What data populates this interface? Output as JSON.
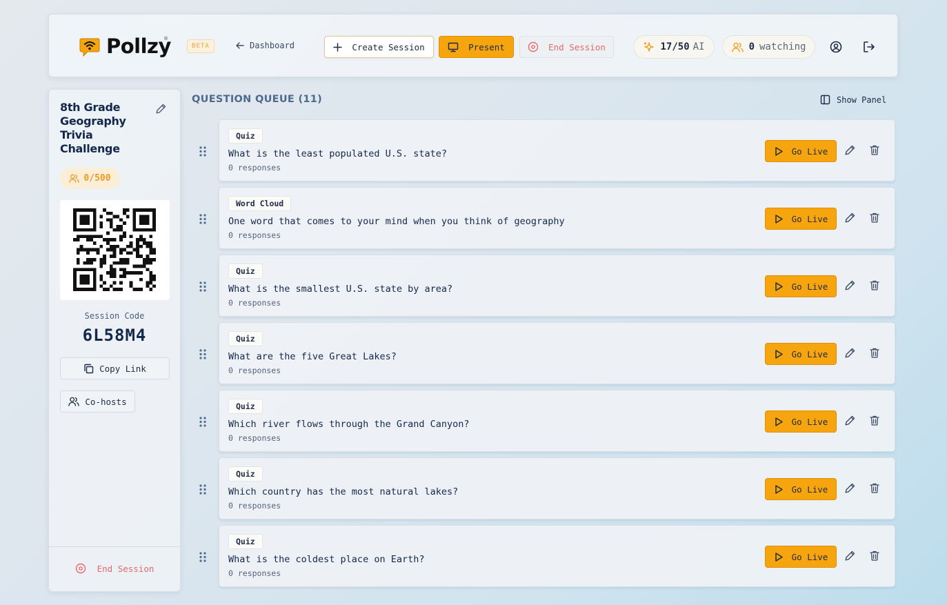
{
  "header": {
    "logo_text": "Pollzy",
    "registered_mark": "®",
    "beta_label": "BETA",
    "dashboard_link": "Dashboard",
    "create_session": "Create Session",
    "present": "Present",
    "end_session": "End Session",
    "ai_count": "17/50",
    "ai_label": "AI",
    "watching_count": "0",
    "watching_label": "watching",
    "icons": [
      "chat-wifi-logo-icon",
      "arrow-left-icon",
      "plus-icon",
      "monitor-icon",
      "stop-circle-icon",
      "sparkles-icon",
      "users-icon",
      "user-circle-icon",
      "logout-icon"
    ]
  },
  "sidebar": {
    "session_title": "8th Grade Geography Trivia Challenge",
    "participant_count": "0/500",
    "session_code_label": "Session Code",
    "session_code": "6L58M4",
    "copy_link": "Copy Link",
    "cohosts": "Co-hosts",
    "end_session": "End Session"
  },
  "queue": {
    "title": "QUESTION QUEUE (11)",
    "show_panel": "Show Panel",
    "go_live_label": "Go Live",
    "items": [
      {
        "type": "Quiz",
        "question": "What is the least populated U.S. state?",
        "responses": "0 responses"
      },
      {
        "type": "Word Cloud",
        "question": "One word that comes to your mind when you think of geography",
        "responses": "0 responses"
      },
      {
        "type": "Quiz",
        "question": "What is the smallest U.S. state by area?",
        "responses": "0 responses"
      },
      {
        "type": "Quiz",
        "question": "What are the five Great Lakes?",
        "responses": "0 responses"
      },
      {
        "type": "Quiz",
        "question": "Which river flows through the Grand Canyon?",
        "responses": "0 responses"
      },
      {
        "type": "Quiz",
        "question": "Which country has the most natural lakes?",
        "responses": "0 responses"
      },
      {
        "type": "Quiz",
        "question": "What is the coldest place on Earth?",
        "responses": "0 responses"
      }
    ]
  },
  "colors": {
    "accent": "#f7a50e",
    "danger": "#e46a6a",
    "navy": "#14284b"
  }
}
